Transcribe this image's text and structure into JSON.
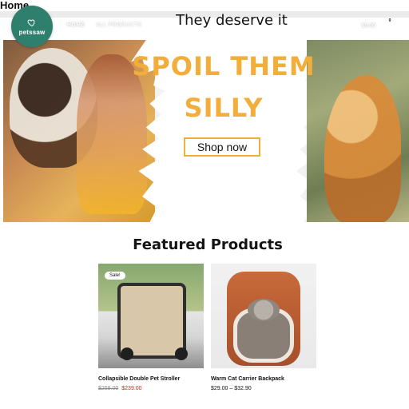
{
  "page": {
    "heading": "Home"
  },
  "header": {
    "logo_text": "petssaw",
    "nav": [
      "HOME",
      "ALL PRODUCTS"
    ],
    "cart_total": "$0.00",
    "cart_count": "0",
    "icons": [
      "cart-icon",
      "user-icon"
    ]
  },
  "hero": {
    "tagline": "They deserve it",
    "headline": "SPOIL THEM SILLY",
    "cta": "Shop now",
    "accent_color": "#f2ae3a"
  },
  "featured": {
    "title": "Featured Products",
    "products": [
      {
        "name": "Collapsible Double Pet Stroller",
        "badge": "Sale!",
        "old_price": "$259.00",
        "sale_price": "$239.00"
      },
      {
        "name": "Warm Cat Carrier Backpack",
        "price_range": "$29.00 – $32.90"
      }
    ]
  }
}
